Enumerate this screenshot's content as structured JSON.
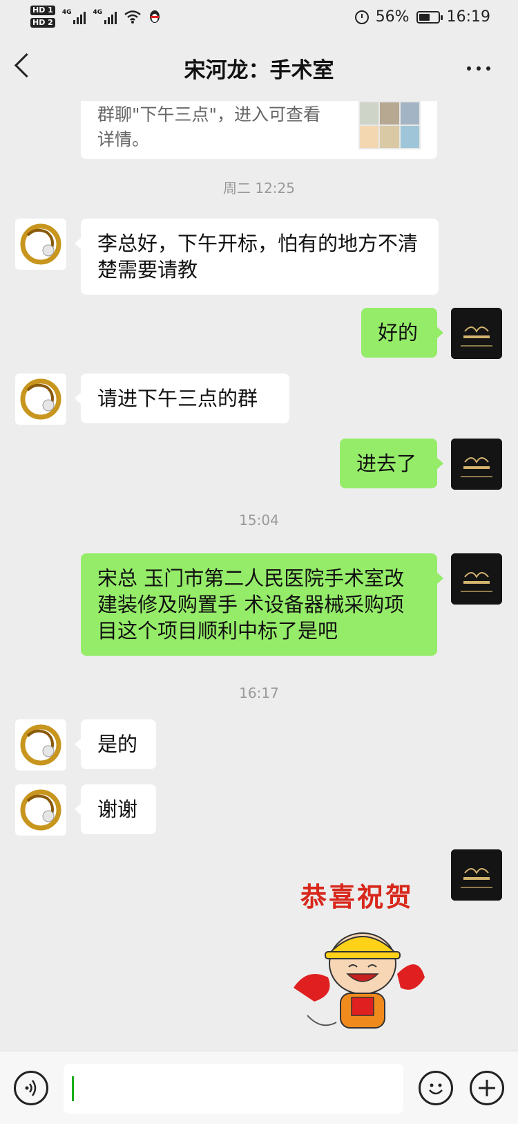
{
  "status_bar": {
    "sim1": "HD 1",
    "sim2": "HD 2",
    "network1": "4G",
    "network2": "4G",
    "battery": "56%",
    "battery_level": 0.56,
    "time": "16:19",
    "icons": [
      "signal-icon",
      "signal-icon",
      "wifi-icon",
      "qq-penguin-icon",
      "alarm-icon",
      "battery-icon"
    ]
  },
  "header": {
    "title": "宋河龙：手术室",
    "back_icon": "chevron-left-icon",
    "more_icon": "more-dots-icon"
  },
  "group_card": {
    "text": "群聊\"下午三点\"，进入可查看详情。",
    "thumbnail_icon": "group-avatar-grid"
  },
  "messages": [
    {
      "type": "time",
      "text": "周二 12:25"
    },
    {
      "type": "text",
      "side": "left",
      "text": "李总好，下午开标，怕有的地方不清楚需要请教"
    },
    {
      "type": "text",
      "side": "right",
      "text": "好的"
    },
    {
      "type": "text",
      "side": "left",
      "text": "请进下午三点的群"
    },
    {
      "type": "text",
      "side": "right",
      "text": "进去了"
    },
    {
      "type": "time",
      "text": "15:04"
    },
    {
      "type": "text",
      "side": "right",
      "text": "宋总 玉门市第二人民医院手术室改建装修及购置手 术设备器械采购项目这个项目顺利中标了是吧"
    },
    {
      "type": "time",
      "text": "16:17"
    },
    {
      "type": "text",
      "side": "left",
      "text": "是的"
    },
    {
      "type": "text",
      "side": "left",
      "text": "谢谢"
    },
    {
      "type": "sticker",
      "side": "right",
      "text": "恭喜祝贺"
    }
  ],
  "input_bar": {
    "voice_icon": "voice-icon",
    "emoji_icon": "emoji-icon",
    "plus_icon": "plus-icon",
    "value": ""
  },
  "colors": {
    "background": "#ededed",
    "bubble_self": "#95ec69",
    "bubble_other": "#ffffff",
    "caret": "#1aad19",
    "sticker_text": "#d8281c"
  }
}
